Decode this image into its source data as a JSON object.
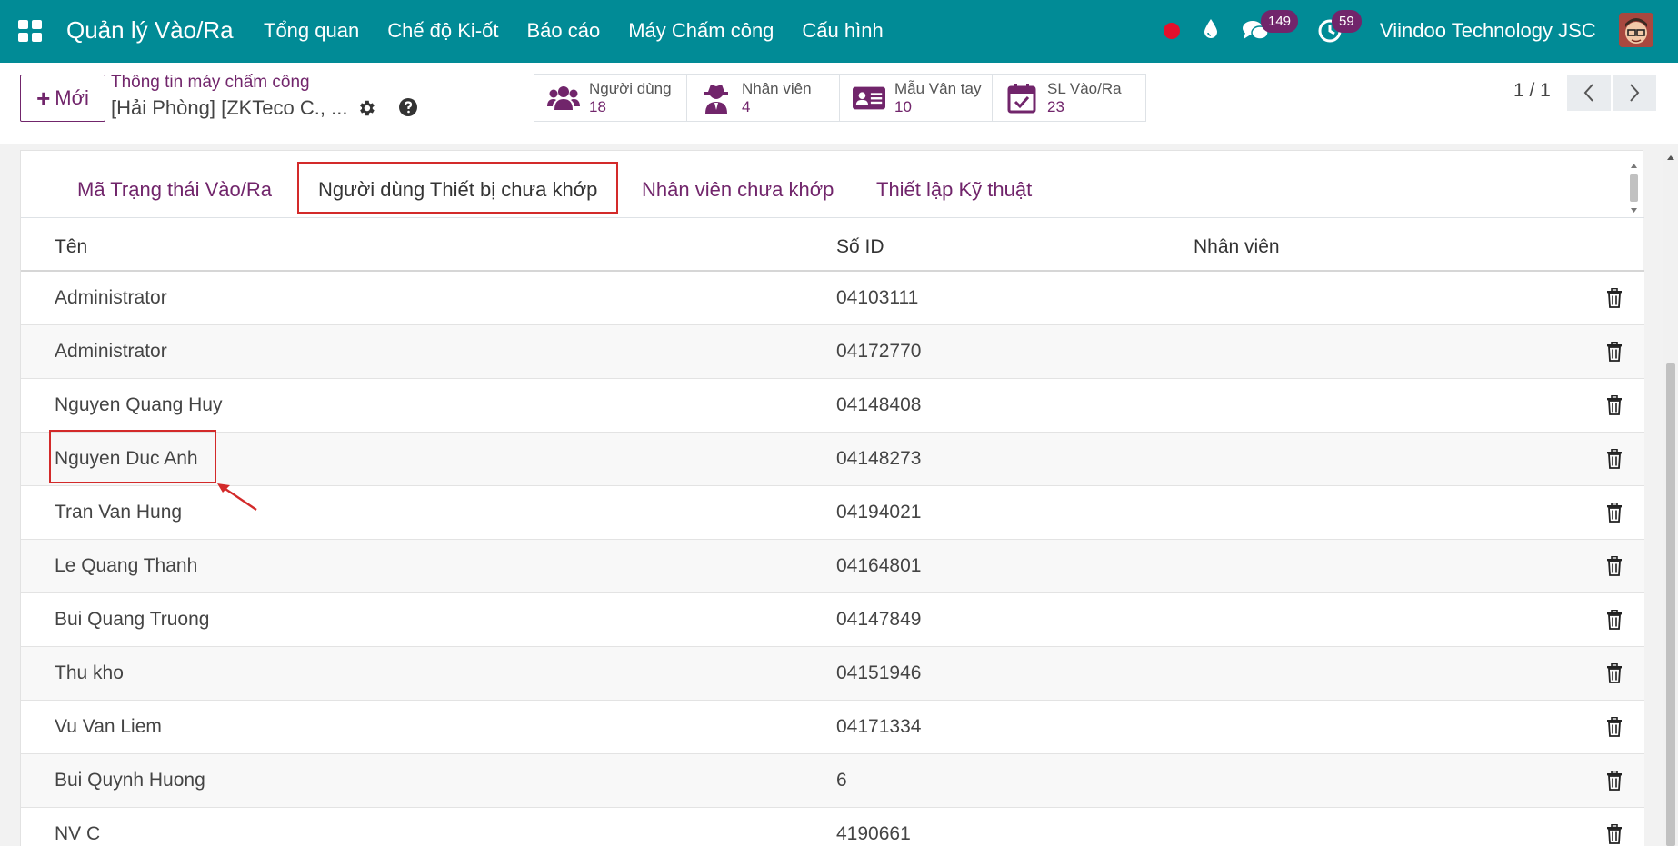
{
  "navbar": {
    "app_title": "Quản lý Vào/Ra",
    "menu": [
      "Tổng quan",
      "Chế độ Ki-ốt",
      "Báo cáo",
      "Máy Chấm công",
      "Cấu hình"
    ],
    "messages_count": "149",
    "activities_count": "59",
    "company": "Viindoo Technology JSC"
  },
  "control": {
    "new_label": "Mới",
    "breadcrumb_parent": "Thông tin máy chấm công",
    "breadcrumb_current": "[Hải Phòng] [ZKTeco C., ...",
    "smart_buttons": [
      {
        "label": "Người dùng",
        "value": "18",
        "icon": "users-icon"
      },
      {
        "label": "Nhân viên",
        "value": "4",
        "icon": "user-secret-icon"
      },
      {
        "label": "Mẫu Vân tay",
        "value": "10",
        "icon": "id-card-icon"
      },
      {
        "label": "SL Vào/Ra",
        "value": "23",
        "icon": "calendar-check-icon"
      }
    ],
    "pager": "1 / 1"
  },
  "tabs": [
    "Mã Trạng thái Vào/Ra",
    "Người dùng Thiết bị chưa khớp",
    "Nhân viên chưa khớp",
    "Thiết lập Kỹ thuật"
  ],
  "active_tab": 1,
  "table": {
    "headers": [
      "Tên",
      "Số ID",
      "Nhân viên"
    ],
    "rows": [
      {
        "name": "Administrator",
        "id": "04103111",
        "employee": ""
      },
      {
        "name": "Administrator",
        "id": "04172770",
        "employee": ""
      },
      {
        "name": "Nguyen Quang Huy",
        "id": "04148408",
        "employee": ""
      },
      {
        "name": "Nguyen Duc Anh",
        "id": "04148273",
        "employee": ""
      },
      {
        "name": "Tran Van Hung",
        "id": "04194021",
        "employee": ""
      },
      {
        "name": "Le Quang Thanh",
        "id": "04164801",
        "employee": ""
      },
      {
        "name": "Bui Quang Truong",
        "id": "04147849",
        "employee": ""
      },
      {
        "name": "Thu kho",
        "id": "04151946",
        "employee": ""
      },
      {
        "name": "Vu Van Liem",
        "id": "04171334",
        "employee": ""
      },
      {
        "name": "Bui Quynh Huong",
        "id": "6",
        "employee": ""
      },
      {
        "name": "NV C",
        "id": "4190661",
        "employee": ""
      }
    ]
  },
  "colors": {
    "navbar": "#018b96",
    "brand_purple": "#71256b",
    "highlight_red": "#d32a2a"
  }
}
